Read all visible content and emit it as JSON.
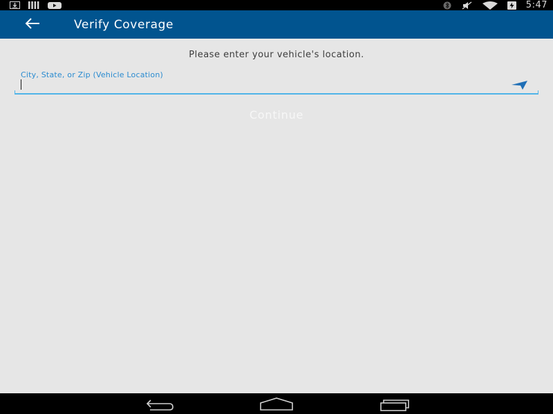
{
  "status_bar": {
    "time": "5:47",
    "left_icons": [
      "download-icon",
      "signal-bars-icon",
      "youtube-icon"
    ],
    "right_icons": [
      "bluetooth-icon",
      "mute-icon",
      "wifi-icon",
      "battery-charging-icon"
    ]
  },
  "app_bar": {
    "title": "Verify Coverage",
    "back_icon": "arrow-left-icon",
    "background": "#01548f"
  },
  "form": {
    "prompt": "Please enter your vehicle's location.",
    "location_label": "City, State, or Zip (Vehicle Location)",
    "location_value": "",
    "location_icon": "navigation-arrow-icon",
    "continue_label": "Continue",
    "accent_color": "#2a8bd0"
  },
  "nav_bar": {
    "buttons": [
      "back-icon",
      "home-icon",
      "recents-icon"
    ]
  }
}
